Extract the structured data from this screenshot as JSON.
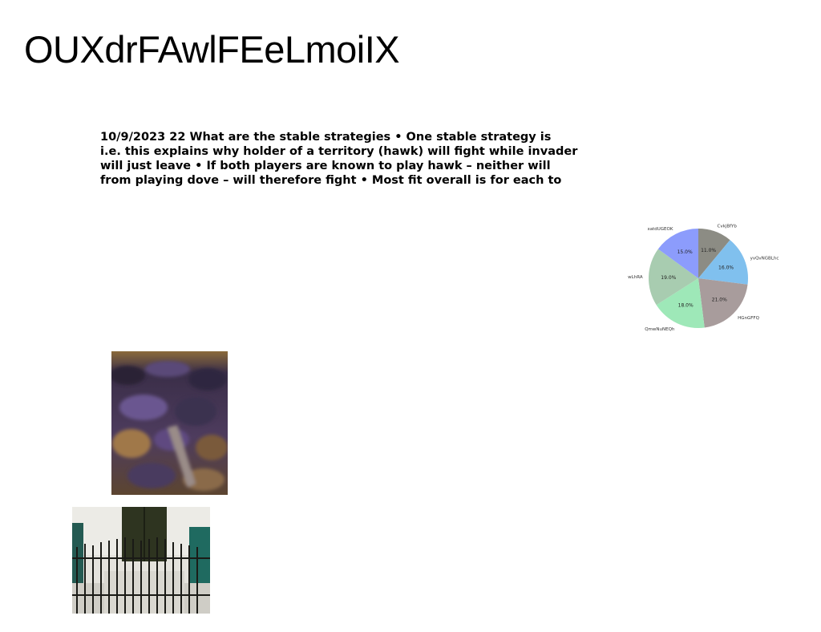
{
  "slide": {
    "title": "OUXdrFAwlFEeLmoiIX",
    "body_lines": [
      "10/9/2023 22 What are the stable strategies • One stable strategy is",
      "i.e. this explains why holder of a territory (hawk) will fight while invader",
      "will just leave • If both players are known to play hawk – neither will",
      "from playing dove – will therefore fight • Most fit overall is for each to"
    ]
  },
  "chart_data": {
    "type": "pie",
    "title": "",
    "start_angle_deg": 90,
    "direction": "clockwise",
    "categories": [
      "CvkjBfYb",
      "yvQvNGBLhc",
      "HGnGFFQ",
      "QmwNuNEQh",
      "wLhRA",
      "xatdUGEOK"
    ],
    "values": [
      11.0,
      16.0,
      21.0,
      18.0,
      19.0,
      15.0
    ],
    "labels": [
      "11.0%",
      "16.0%",
      "21.0%",
      "18.0%",
      "19.0%",
      "15.0%"
    ],
    "colors": [
      "#8c8c84",
      "#80c0ee",
      "#a89c9c",
      "#9ee8b8",
      "#a8ccb0",
      "#8c9cfc"
    ]
  },
  "images": {
    "leaves_photo": "dark-leaves-photo",
    "gate_photo": "iron-gate-photo"
  }
}
